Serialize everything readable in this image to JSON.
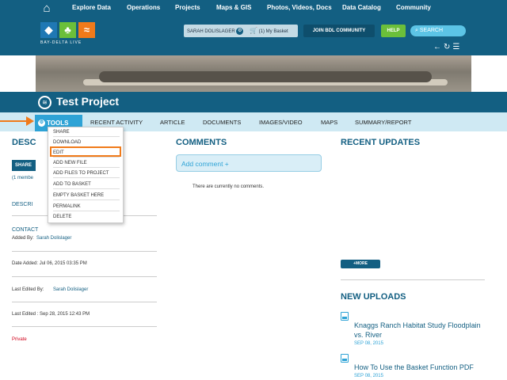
{
  "topnav": {
    "home_icon": "home-icon",
    "items": [
      "Explore Data",
      "Operations",
      "Projects",
      "Maps & GIS",
      "Photos, Videos, Docs",
      "Data Catalog",
      "Community"
    ]
  },
  "header": {
    "logo_text": "BAY-DELTA LIVE",
    "user_name": "SARAH DOLISLAGER",
    "basket_label": "(1) My Basket",
    "join_label": "JOIN BDL COMMUNITY",
    "help_label": "HELP",
    "search_placeholder": "SEARCH"
  },
  "project": {
    "title": "Test Project"
  },
  "tabs": {
    "tools": "TOOLS",
    "items": [
      "RECENT ACTIVITY",
      "ARTICLE",
      "DOCUMENTS",
      "IMAGES/VIDEO",
      "MAPS",
      "SUMMARY/REPORT"
    ]
  },
  "tools_menu": [
    "SHARE",
    "DOWNLOAD",
    "EDIT",
    "ADD NEW FILE",
    "ADD FILES TO PROJECT",
    "ADD TO BASKET",
    "EMPTY BASKET HERE",
    "PERMALINK",
    "DELETE"
  ],
  "left": {
    "heading": "DESC",
    "share_label": "SHARE",
    "members": "(1 membe",
    "description": "DESCRI",
    "contact": "CONTACT",
    "added_by_label": "Added By:",
    "added_by": "Sarah Dolislager",
    "date_added": "Date Added: Jul 06, 2015 03:35 PM",
    "last_edited_by_label": "Last Edited By:",
    "last_edited_by": "Sarah Dolislager",
    "last_edited": "Last Edited : Sep 28, 2015 12:43 PM",
    "privacy": "Private"
  },
  "comments": {
    "heading": "COMMENTS",
    "add_label": "Add comment +",
    "empty_text": "There are currently no comments."
  },
  "updates": {
    "heading": "RECENT UPDATES",
    "more_label": "+MORE",
    "new_uploads_heading": "NEW UPLOADS",
    "uploads": [
      {
        "title": "Knaggs Ranch Habitat Study Floodplain vs. River",
        "date": "SEP 08, 2015"
      },
      {
        "title": "How To Use the Basket Function PDF",
        "date": "SEP 08, 2015"
      }
    ]
  },
  "colors": {
    "brand": "#135f82",
    "accent": "#2ea3d6",
    "highlight": "#f07a1a",
    "help": "#6bbf3a",
    "private": "#d0021b"
  }
}
